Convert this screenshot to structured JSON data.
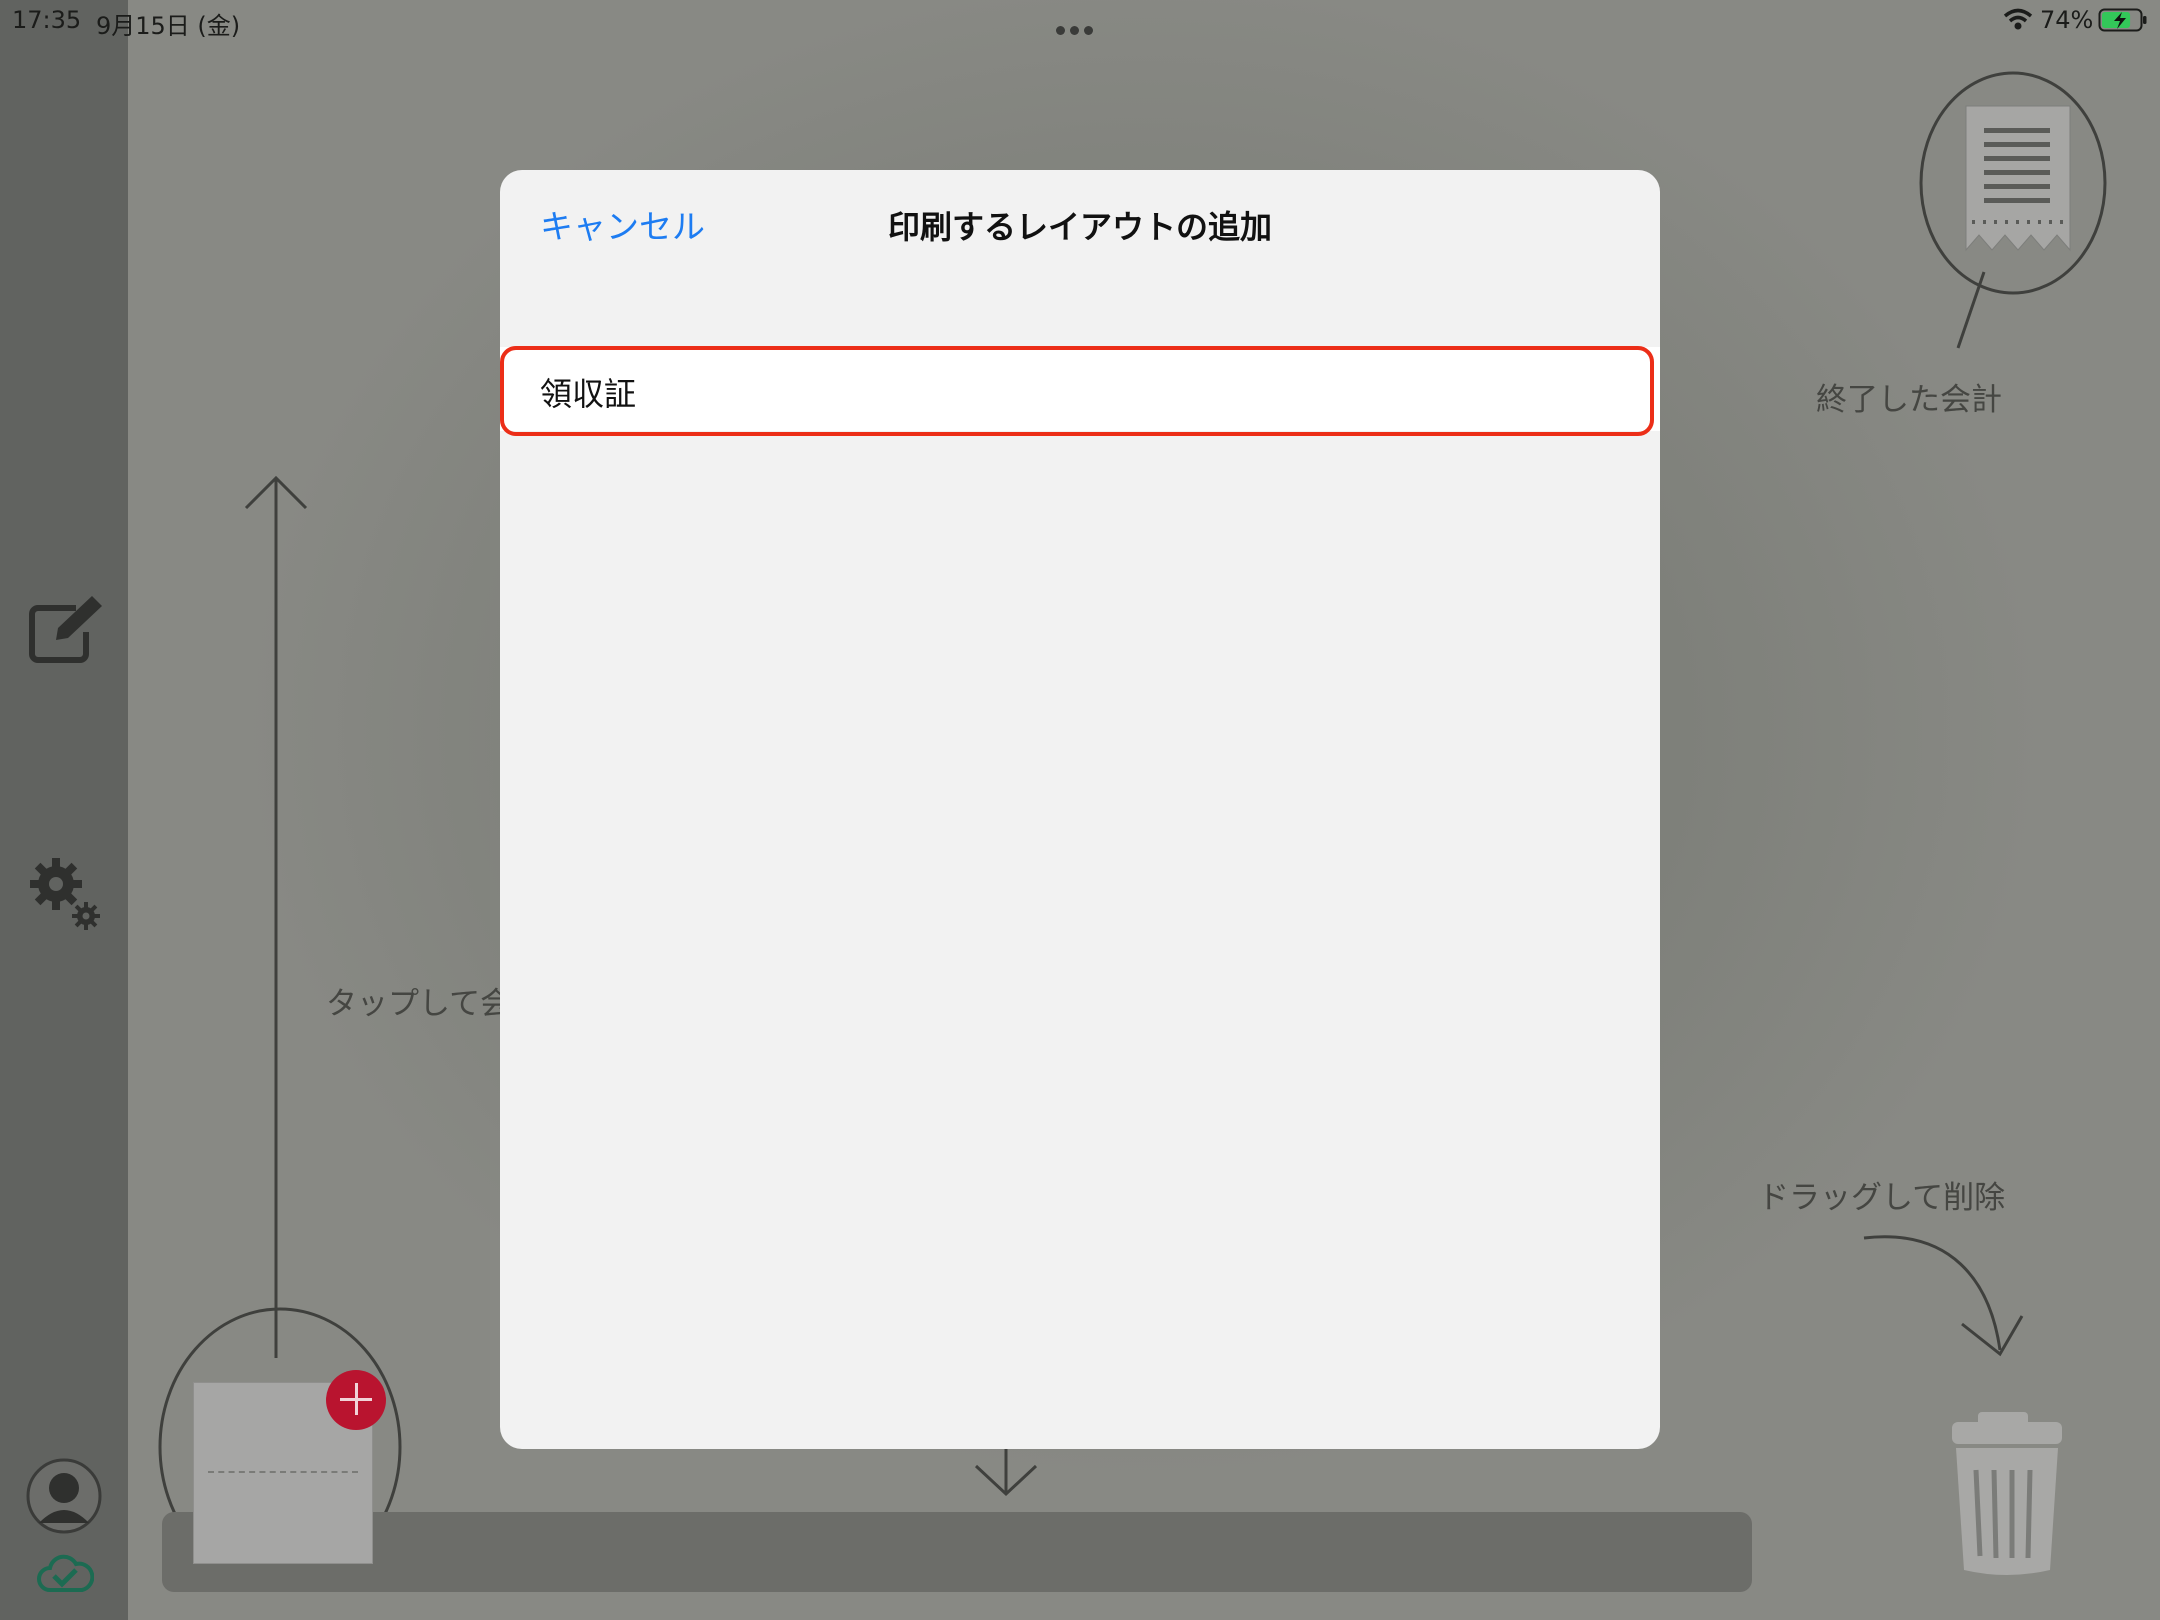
{
  "status_bar": {
    "time": "17:35",
    "date": "9月15日 (金)",
    "battery_percent": "74%",
    "battery_level": 0.74,
    "charging": true,
    "icons": [
      "wifi-icon",
      "battery-charging-icon",
      "multitasking-dots-icon"
    ]
  },
  "sidebar": {
    "icons": [
      "edit-icon",
      "settings-gears-icon",
      "user-avatar-icon",
      "cloud-sync-check-icon"
    ]
  },
  "background_hints": {
    "finished_accounts": "終了した会計",
    "tap_to_start": "タップして会",
    "drag_to_delete": "ドラッグして削除",
    "icons": [
      "receipt-icon",
      "trash-icon",
      "add-icon",
      "up-arrow-icon",
      "down-arrow-icon",
      "curved-arrow-icon"
    ]
  },
  "modal": {
    "title": "印刷するレイアウトの追加",
    "cancel_label": "キャンセル",
    "items": [
      {
        "label": "領収証"
      }
    ]
  },
  "colors": {
    "accent": "#1d7cf2",
    "highlight": "#ec2e18",
    "add_badge": "#b9142f",
    "battery_fill": "#33c759"
  }
}
